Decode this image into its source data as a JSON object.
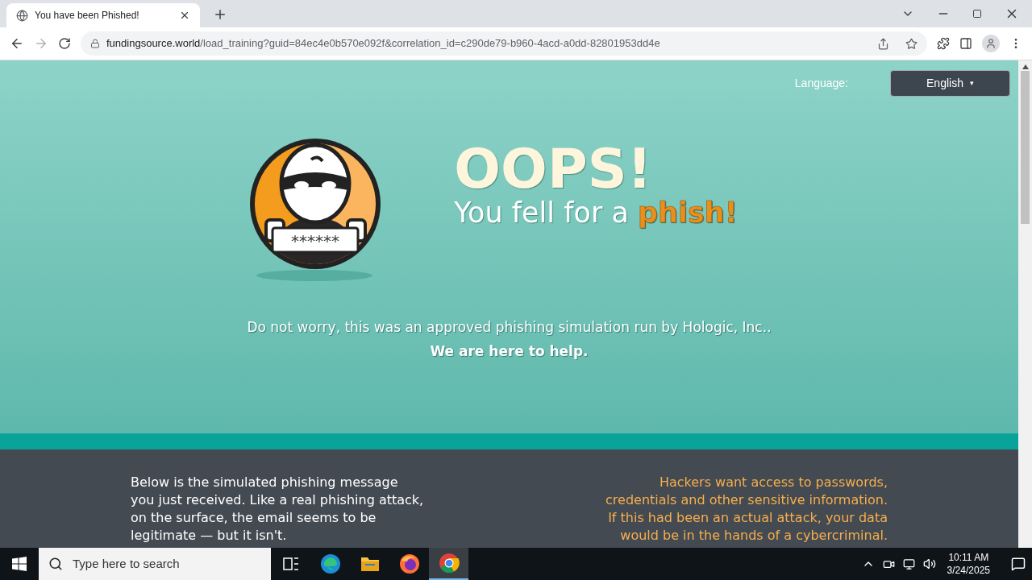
{
  "browser": {
    "tab": {
      "title": "You have been Phished!",
      "selected": true
    },
    "url": {
      "host": "fundingsource.world",
      "path": "/load_training?guid=84ec4e0b570e092f&correlation_id=c290de79-b960-4acd-a0dd-82801953dd4e"
    }
  },
  "language": {
    "label": "Language:",
    "value": "English",
    "caret": "▾"
  },
  "hero": {
    "sign": "******",
    "headline": "OOPS!",
    "subline": "You fell for a",
    "subline_accent": "phish!",
    "notice": "Do not worry, this was an approved phishing simulation run by Hologic, Inc..",
    "help": "We are here to help."
  },
  "info": {
    "left_lines": [
      "Below is the simulated phishing message",
      "you just received. Like a real phishing attack,",
      "on the surface, the email seems to be",
      "legitimate — but it isn't."
    ],
    "right_lines": [
      "Hackers want access to passwords,",
      "credentials and other sensitive information.",
      "If this had been an actual attack, your data",
      "would be in the hands of a cybercriminal."
    ]
  },
  "taskbar": {
    "search_placeholder": "Type here to search",
    "time": "10:11 AM",
    "date": "3/24/2025",
    "apps": [
      {
        "kind": "taskview",
        "selected": false
      },
      {
        "kind": "edge",
        "selected": false
      },
      {
        "kind": "explorer",
        "selected": false
      },
      {
        "kind": "firefox",
        "selected": false
      },
      {
        "kind": "chrome",
        "selected": true
      }
    ]
  }
}
